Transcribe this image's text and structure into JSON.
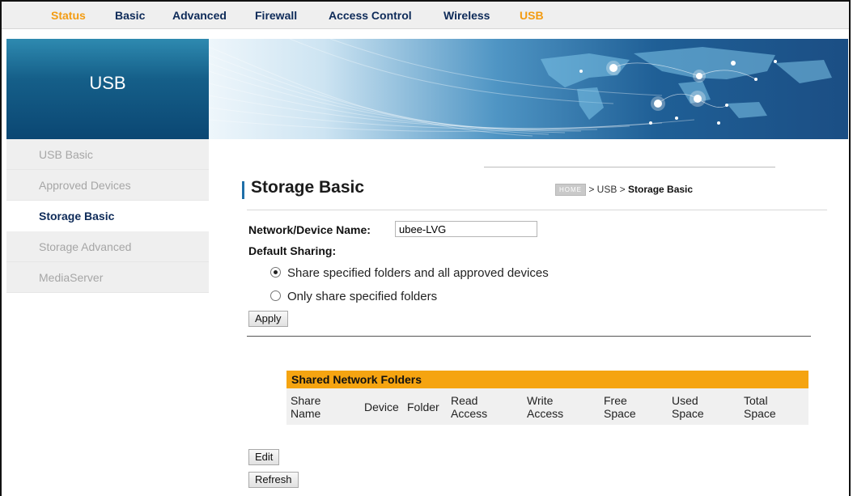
{
  "nav": {
    "items": [
      {
        "label": "Status",
        "highlight": true
      },
      {
        "label": "Basic",
        "highlight": false
      },
      {
        "label": "Advanced",
        "highlight": false
      },
      {
        "label": "Firewall",
        "highlight": false
      },
      {
        "label": "Access Control",
        "highlight": false
      },
      {
        "label": "Wireless",
        "highlight": false
      },
      {
        "label": "USB",
        "highlight": true
      }
    ]
  },
  "banner": {
    "title": "USB"
  },
  "sidebar": {
    "items": [
      {
        "label": "USB Basic"
      },
      {
        "label": "Approved Devices"
      },
      {
        "label": "Storage Basic"
      },
      {
        "label": "Storage Advanced"
      },
      {
        "label": "MediaServer"
      }
    ],
    "active": "Storage Basic"
  },
  "page": {
    "title": "Storage Basic",
    "breadcrumb": {
      "home_icon": "HOME",
      "path": " > USB > ",
      "current": "Storage Basic"
    }
  },
  "form": {
    "device_name_label": "Network/Device Name:",
    "device_name_value": "ubee-LVG",
    "default_sharing_label": "Default Sharing:",
    "option_1": "Share specified folders and all approved devices",
    "option_2": "Only share specified folders",
    "selected_option": 1,
    "apply_label": "Apply"
  },
  "folders_table": {
    "title": "Shared Network Folders",
    "columns": {
      "share_name_1": "Share",
      "share_name_2": "Name",
      "device": "Device",
      "folder": "Folder",
      "read_1": "Read",
      "read_2": "Access",
      "write_1": "Write",
      "write_2": "Access",
      "free_1": "Free",
      "free_2": "Space",
      "used_1": "Used",
      "used_2": "Space",
      "total_1": "Total",
      "total_2": "Space"
    },
    "rows": []
  },
  "actions": {
    "edit_label": "Edit",
    "refresh_label": "Refresh"
  },
  "colors": {
    "accent": "#f39c12",
    "nav_text": "#0d2a58",
    "table_header": "#f5a411",
    "banner": "#155f89"
  }
}
